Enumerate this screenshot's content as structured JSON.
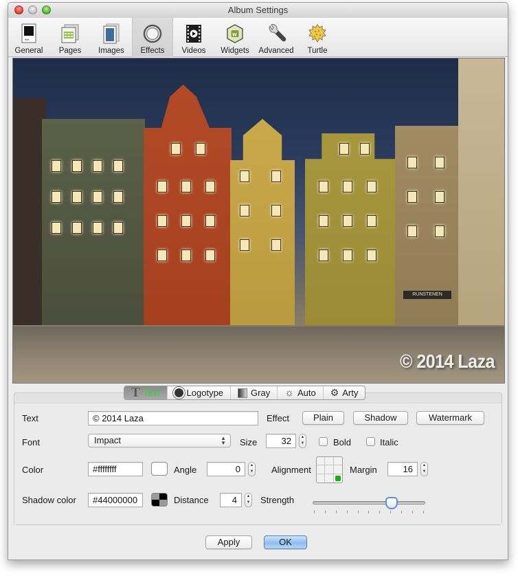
{
  "window": {
    "title": "Album Settings"
  },
  "toolbar": {
    "items": [
      {
        "label": "General",
        "icon": "general-icon",
        "active": false
      },
      {
        "label": "Pages",
        "icon": "pages-icon",
        "active": false
      },
      {
        "label": "Images",
        "icon": "images-icon",
        "active": false
      },
      {
        "label": "Effects",
        "icon": "effects-icon",
        "active": true
      },
      {
        "label": "Videos",
        "icon": "videos-icon",
        "active": false
      },
      {
        "label": "Widgets",
        "icon": "widgets-icon",
        "active": false
      },
      {
        "label": "Advanced",
        "icon": "wrench-icon",
        "active": false
      },
      {
        "label": "Turtle",
        "icon": "turtle-icon",
        "active": false
      }
    ]
  },
  "preview": {
    "watermark_text": "© 2014 Laza",
    "sign_text": "RUNSTENEN"
  },
  "effect_tabs": {
    "items": [
      {
        "label": "Text",
        "icon": "text-t-icon",
        "selected": true
      },
      {
        "label": "Logotype",
        "icon": "logotype-icon",
        "selected": false
      },
      {
        "label": "Gray",
        "icon": "gray-gradient-icon",
        "selected": false
      },
      {
        "label": "Auto",
        "icon": "sun-icon",
        "selected": false
      },
      {
        "label": "Arty",
        "icon": "gear-icon",
        "selected": false
      }
    ],
    "selected_color": "#22e022"
  },
  "form": {
    "text_label": "Text",
    "text_value": "© 2014 Laza",
    "effect_label": "Effect",
    "effect_buttons": [
      "Plain",
      "Shadow",
      "Watermark"
    ],
    "font_label": "Font",
    "font_value": "Impact",
    "size_label": "Size",
    "size_value": "32",
    "bold_label": "Bold",
    "bold_checked": false,
    "italic_label": "Italic",
    "italic_checked": false,
    "color_label": "Color",
    "color_value": "#ffffffff",
    "angle_label": "Angle",
    "angle_value": "0",
    "alignment_label": "Alignment",
    "alignment_selected": "bottom-right",
    "margin_label": "Margin",
    "margin_value": "16",
    "shadow_color_label": "Shadow color",
    "shadow_color_value": "#44000000",
    "distance_label": "Distance",
    "distance_value": "4",
    "strength_label": "Strength",
    "strength_fraction": 0.7,
    "strength_ticks": 11
  },
  "footer": {
    "apply_label": "Apply",
    "ok_label": "OK"
  }
}
